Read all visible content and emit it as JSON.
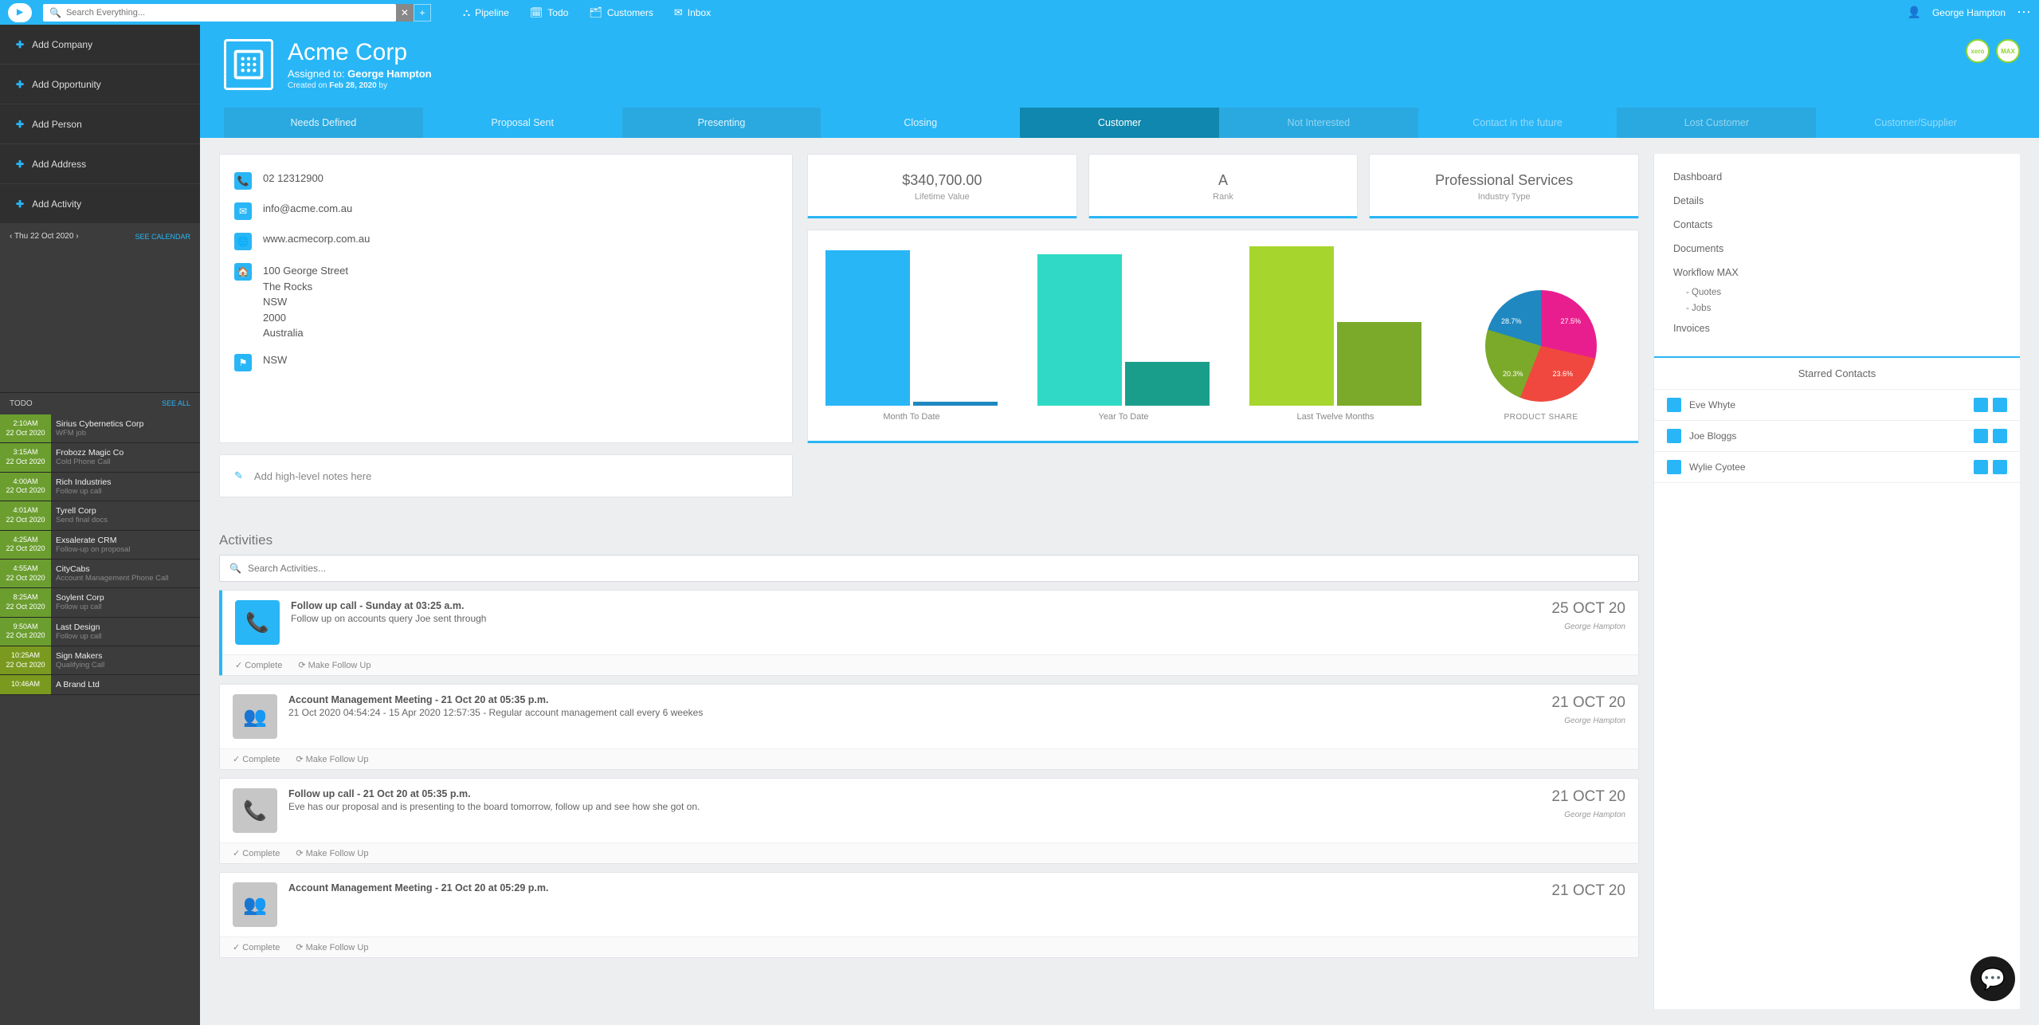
{
  "search": {
    "placeholder": "Search Everything..."
  },
  "topnav": [
    {
      "label": "Pipeline"
    },
    {
      "label": "Todo"
    },
    {
      "label": "Customers"
    },
    {
      "label": "Inbox"
    }
  ],
  "user": {
    "name": "George Hampton"
  },
  "sidebar_add": [
    {
      "label": "Add Company"
    },
    {
      "label": "Add Opportunity"
    },
    {
      "label": "Add Person"
    },
    {
      "label": "Add Address"
    },
    {
      "label": "Add Activity"
    }
  ],
  "calendar": {
    "date": "Thu 22 Oct 2020",
    "link": "SEE CALENDAR"
  },
  "todo_header": {
    "title": "TODO",
    "link": "SEE ALL"
  },
  "todos": [
    {
      "time": "2:10AM",
      "date": "22 Oct 2020",
      "title": "Sirius Cybernetics Corp",
      "sub": "WFM job",
      "cls": "green"
    },
    {
      "time": "3:15AM",
      "date": "22 Oct 2020",
      "title": "Frobozz Magic Co",
      "sub": "Cold Phone Call",
      "cls": "green"
    },
    {
      "time": "4:00AM",
      "date": "22 Oct 2020",
      "title": "Rich Industries",
      "sub": "Follow up call",
      "cls": "green"
    },
    {
      "time": "4:01AM",
      "date": "22 Oct 2020",
      "title": "Tyrell Corp",
      "sub": "Send final docs",
      "cls": "green"
    },
    {
      "time": "4:25AM",
      "date": "22 Oct 2020",
      "title": "Exsalerate CRM",
      "sub": "Follow-up on proposal",
      "cls": "green"
    },
    {
      "time": "4:55AM",
      "date": "22 Oct 2020",
      "title": "CityCabs",
      "sub": "Account Management Phone Call",
      "cls": "green"
    },
    {
      "time": "8:25AM",
      "date": "22 Oct 2020",
      "title": "Soylent Corp",
      "sub": "Follow up call",
      "cls": "green"
    },
    {
      "time": "9:50AM",
      "date": "22 Oct 2020",
      "title": "Last Design",
      "sub": "Follow up call",
      "cls": "green"
    },
    {
      "time": "10:25AM",
      "date": "22 Oct 2020",
      "title": "Sign Makers",
      "sub": "Qualifying Call",
      "cls": "olive"
    },
    {
      "time": "10:46AM",
      "date": "",
      "title": "A Brand Ltd",
      "sub": "",
      "cls": "olive"
    }
  ],
  "company": {
    "name": "Acme Corp",
    "assigned_label": "Assigned to:",
    "assigned_to": "George Hampton",
    "created_label": "Created on",
    "created_on": "Feb 28, 2020",
    "created_by": "by"
  },
  "badges": [
    "xero",
    "MAX"
  ],
  "stages": [
    {
      "label": "Needs Defined",
      "state": ""
    },
    {
      "label": "Proposal Sent",
      "state": "alt"
    },
    {
      "label": "Presenting",
      "state": ""
    },
    {
      "label": "Closing",
      "state": "alt"
    },
    {
      "label": "Customer",
      "state": "active"
    },
    {
      "label": "Not Interested",
      "state": "dim"
    },
    {
      "label": "Contact in the future",
      "state": "dim alt"
    },
    {
      "label": "Lost Customer",
      "state": "dim"
    },
    {
      "label": "Customer/Supplier",
      "state": "dim alt"
    }
  ],
  "contact": {
    "phone": "02 12312900",
    "email": "info@acme.com.au",
    "website": "www.acmecorp.com.au",
    "address": [
      "100 George Street",
      "The Rocks",
      "NSW",
      "2000",
      "Australia"
    ],
    "region": "NSW"
  },
  "stats": [
    {
      "value": "$340,700.00",
      "label": "Lifetime Value"
    },
    {
      "value": "A",
      "label": "Rank"
    },
    {
      "value": "Professional Services",
      "label": "Industry Type"
    }
  ],
  "chart_data": {
    "type": "bar",
    "title": "",
    "groups": [
      {
        "label": "Month To Date",
        "values": [
          195,
          5
        ],
        "colors": [
          "#29b6f6",
          "#1f88c0"
        ]
      },
      {
        "label": "Year To Date",
        "values": [
          190,
          55
        ],
        "colors": [
          "#2fd9c5",
          "#1a9e8c"
        ]
      },
      {
        "label": "Last Twelve Months",
        "values": [
          200,
          105
        ],
        "colors": [
          "#a6d62e",
          "#7baa2a"
        ]
      }
    ],
    "y_basis": "pixel-height-relative",
    "note": "bars shown without axis; heights are relative estimates"
  },
  "pie": {
    "title": "PRODUCT SHARE",
    "slices": [
      {
        "pct": "28.7%",
        "color": "#e91e8e"
      },
      {
        "pct": "27.5%",
        "color": "#f0483e"
      },
      {
        "pct": "23.6%",
        "color": "#7baa2a"
      },
      {
        "pct": "20.3%",
        "color": "#1f88c0"
      }
    ]
  },
  "notes_placeholder": "Add high-level notes here",
  "activities_header": "Activities",
  "activities_search_placeholder": "Search Activities...",
  "activities": [
    {
      "title": "Follow up call - Sunday at 03:25 a.m.",
      "desc": "Follow up on accounts query Joe sent through",
      "date": "25 OCT 20",
      "user": "George Hampton",
      "icon": "phone",
      "tone": "blue",
      "highlight": true
    },
    {
      "title": "Account Management Meeting - 21 Oct 20 at 05:35 p.m.",
      "desc": "21 Oct 2020 04:54:24 - 15 Apr 2020 12:57:35 - Regular account management call every 6 weekes",
      "date": "21 OCT 20",
      "user": "George Hampton",
      "icon": "group",
      "tone": "grey",
      "highlight": false
    },
    {
      "title": "Follow up call - 21 Oct 20 at 05:35 p.m.",
      "desc": "Eve has our proposal and is presenting to the board tomorrow, follow up and see how she got on.",
      "date": "21 OCT 20",
      "user": "George Hampton",
      "icon": "phone",
      "tone": "grey",
      "highlight": false
    },
    {
      "title": "Account Management Meeting - 21 Oct 20 at 05:29 p.m.",
      "desc": "",
      "date": "21 OCT 20",
      "user": "",
      "icon": "group",
      "tone": "grey",
      "highlight": false
    }
  ],
  "activity_actions": {
    "complete": "Complete",
    "followup": "Make Follow Up"
  },
  "right_nav": [
    "Dashboard",
    "Details",
    "Contacts",
    "Documents"
  ],
  "right_nav_wfm": {
    "label": "Workflow MAX",
    "subs": [
      "- Quotes",
      "- Jobs"
    ]
  },
  "right_nav_last": "Invoices",
  "starred_header": "Starred Contacts",
  "starred": [
    {
      "name": "Eve Whyte"
    },
    {
      "name": "Joe Bloggs"
    },
    {
      "name": "Wylie Cyotee"
    }
  ]
}
